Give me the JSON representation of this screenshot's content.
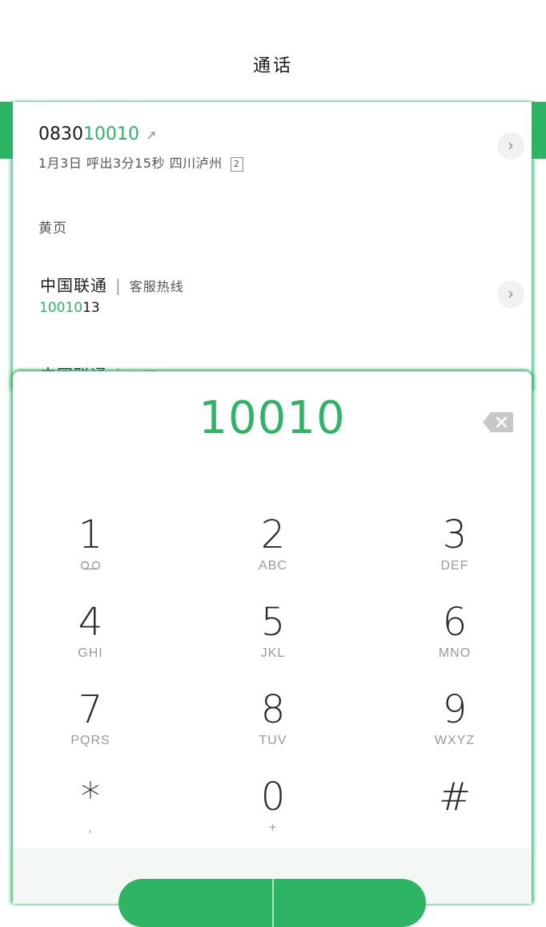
{
  "header": {
    "title": "通话"
  },
  "recent_call": {
    "number_prefix": "0830",
    "number_match": "10010",
    "direction_icon": "outgoing-arrow-icon",
    "direction_symbol": "↗",
    "meta": "1月3日 呼出3分15秒 四川泸州",
    "count": "2"
  },
  "yellow_pages": {
    "label": "黄页",
    "entries": [
      {
        "name": "中国联通",
        "tag": "客服热线",
        "number_match": "10010",
        "number_rest": "13"
      },
      {
        "name": "中国联通",
        "tag": "客服"
      }
    ]
  },
  "dialer": {
    "input_value": "10010",
    "keys": [
      {
        "digit": "1",
        "letters": ""
      },
      {
        "digit": "2",
        "letters": "ABC"
      },
      {
        "digit": "3",
        "letters": "DEF"
      },
      {
        "digit": "4",
        "letters": "GHI"
      },
      {
        "digit": "5",
        "letters": "JKL"
      },
      {
        "digit": "6",
        "letters": "MNO"
      },
      {
        "digit": "7",
        "letters": "PQRS"
      },
      {
        "digit": "8",
        "letters": "TUV"
      },
      {
        "digit": "9",
        "letters": "WXYZ"
      },
      {
        "digit": "*",
        "letters": ","
      },
      {
        "digit": "0",
        "letters": "+"
      },
      {
        "digit": "#",
        "letters": ""
      }
    ]
  },
  "colors": {
    "accent": "#2db565",
    "text": "#1a1a1a",
    "muted": "#9a9a9a"
  }
}
